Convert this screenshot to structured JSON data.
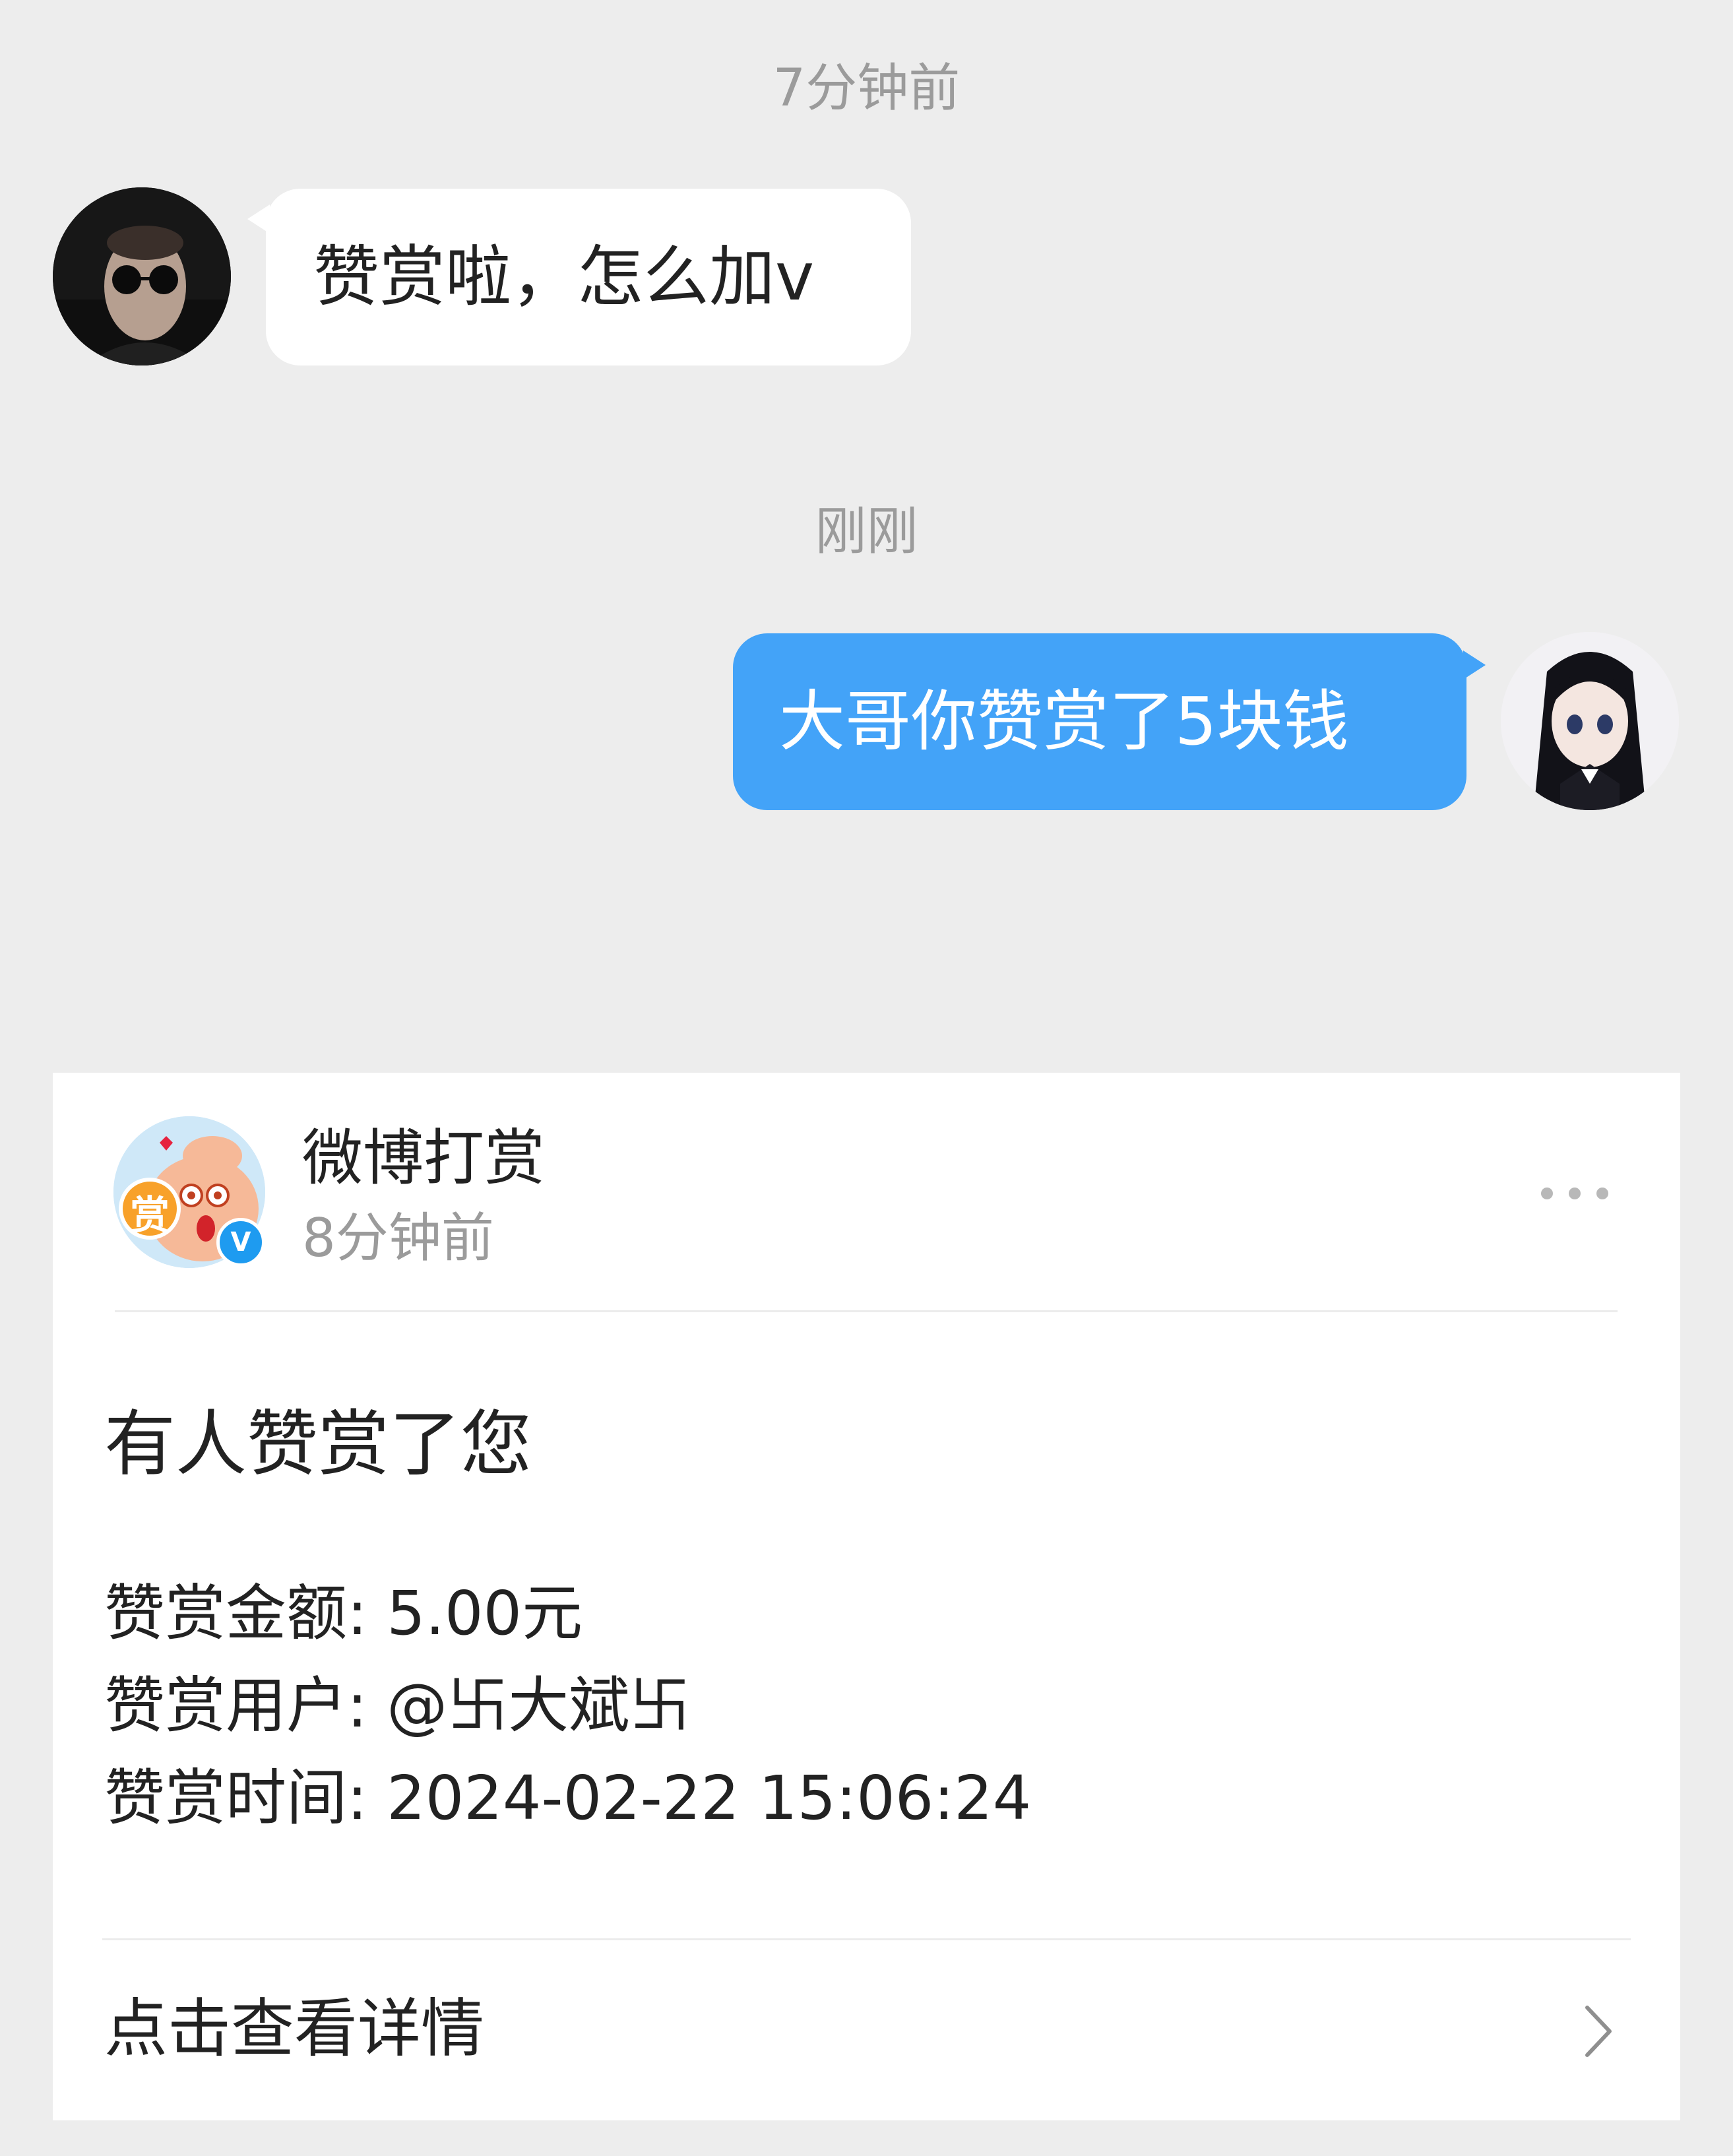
{
  "conversation": {
    "messages": [
      {
        "timestamp": "7分钟前",
        "direction": "incoming",
        "text": "赞赏啦，怎么加v"
      },
      {
        "timestamp": "刚刚",
        "direction": "outgoing",
        "text": "大哥你赞赏了5块钱"
      }
    ]
  },
  "card": {
    "sender_name": "微博打赏",
    "sender_time": "8分钟前",
    "avatar_badge": "赏",
    "verified_mark": "V",
    "title": "有人赞赏了您",
    "details": [
      "赞赏金额: 5.00元",
      "赞赏用户: @卐大斌卐",
      "赞赏时间: 2024-02-22 15:06:24"
    ],
    "footer_label": "点击查看详情"
  },
  "colors": {
    "background": "#ededed",
    "outgoing_bubble": "#43a3f8",
    "incoming_bubble": "#ffffff",
    "timestamp_text": "#9b9b9b",
    "verified_badge": "#1e9bf0"
  }
}
